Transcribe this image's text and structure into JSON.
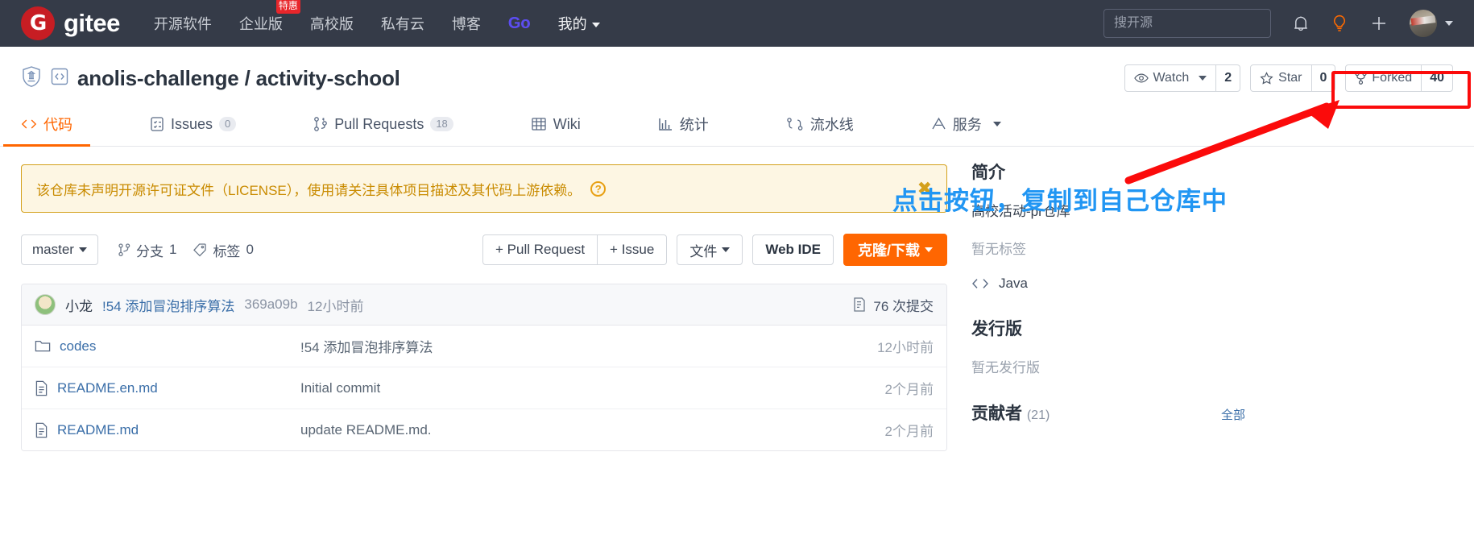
{
  "header": {
    "logo_text": "G",
    "brand": "gitee",
    "nav": [
      {
        "label": "开源软件",
        "badge": null,
        "style": "muted"
      },
      {
        "label": "企业版",
        "badge": "特惠",
        "style": "muted"
      },
      {
        "label": "高校版",
        "badge": null,
        "style": "muted"
      },
      {
        "label": "私有云",
        "badge": null,
        "style": "muted"
      },
      {
        "label": "博客",
        "badge": null,
        "style": "muted"
      },
      {
        "label": "Go",
        "badge": null,
        "style": "go"
      },
      {
        "label": "我的",
        "badge": null,
        "style": "white-caret"
      }
    ],
    "search_placeholder": "搜开源",
    "icons": [
      "bell-icon",
      "lightbulb-icon",
      "plus-icon",
      "avatar"
    ]
  },
  "repo": {
    "owner": "anolis-challenge",
    "separator": "/",
    "name": "activity-school",
    "actions": [
      {
        "label": "Watch",
        "count": "2",
        "icon": "eye-icon",
        "has_caret": true
      },
      {
        "label": "Star",
        "count": "0",
        "icon": "star-icon",
        "has_caret": false
      },
      {
        "label": "Forked",
        "count": "40",
        "icon": "fork-icon",
        "has_caret": false
      }
    ]
  },
  "tabs": [
    {
      "label": "代码",
      "icon": "code-icon",
      "count": null,
      "active": true
    },
    {
      "label": "Issues",
      "icon": "issues-icon",
      "count": "0",
      "active": false
    },
    {
      "label": "Pull Requests",
      "icon": "pull-request-icon",
      "count": "18",
      "active": false
    },
    {
      "label": "Wiki",
      "icon": "book-icon",
      "count": null,
      "active": false
    },
    {
      "label": "统计",
      "icon": "chart-icon",
      "count": null,
      "active": false
    },
    {
      "label": "流水线",
      "icon": "pipeline-icon",
      "count": null,
      "active": false
    },
    {
      "label": "服务",
      "icon": "service-icon",
      "count": null,
      "active": false,
      "has_caret": true
    }
  ],
  "license_banner": {
    "text": "该仓库未声明开源许可证文件（LICENSE），使用请关注具体项目描述及其代码上游依赖。",
    "help_mark": "?",
    "close_mark": "✖"
  },
  "toolbar": {
    "branch": "master",
    "branches_label": "分支",
    "branches_count": "1",
    "tags_label": "标签",
    "tags_count": "0",
    "pull_request_btn": "+ Pull Request",
    "issue_btn": "+ Issue",
    "files_btn": "文件",
    "web_ide_btn": "Web IDE",
    "clone_btn": "克隆/下载"
  },
  "commit": {
    "author": "小龙",
    "message": "!54 添加冒泡排序算法",
    "sha": "369a09b",
    "time": "12小时前",
    "commit_count": "76 次提交"
  },
  "files": [
    {
      "name": "codes",
      "type": "folder",
      "message": "!54 添加冒泡排序算法",
      "time": "12小时前"
    },
    {
      "name": "README.en.md",
      "type": "file",
      "message": "Initial commit",
      "time": "2个月前"
    },
    {
      "name": "README.md",
      "type": "file",
      "message": "update README.md.",
      "time": "2个月前"
    }
  ],
  "sidebar": {
    "about_title": "简介",
    "description": "高校活动-pr仓库",
    "tags_empty": "暂无标签",
    "language": "Java",
    "releases_title": "发行版",
    "releases_empty": "暂无发行版",
    "contributors_title": "贡献者",
    "contributors_count": "(21)",
    "contributors_more": "全部"
  },
  "annotations": {
    "callout_text": "点击按钮，复制到自己仓库中",
    "callout_color": "#2196f3",
    "highlight_color": "#fb0b0b"
  }
}
